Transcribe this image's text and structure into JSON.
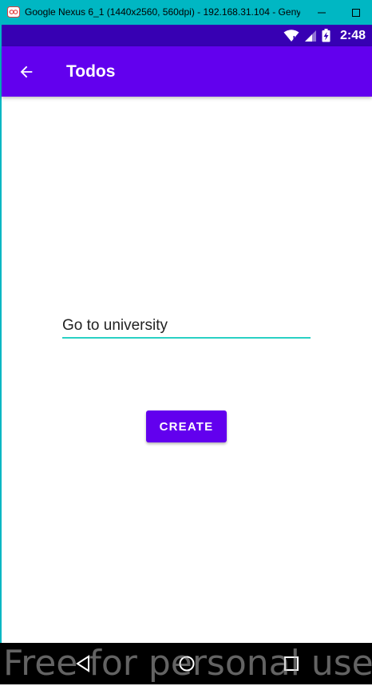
{
  "window": {
    "title": "Google Nexus 6_1 (1440x2560, 560dpi) - 192.168.31.104 - Genym..."
  },
  "status_bar": {
    "time": "2:48",
    "icons": [
      "wifi-icon",
      "signal-icon",
      "battery-charging-icon"
    ]
  },
  "app_bar": {
    "title": "Todos",
    "back_icon": "arrow-back-icon"
  },
  "form": {
    "todo_value": "Go to university",
    "create_label": "CREATE"
  },
  "nav_bar": {
    "icons": [
      "nav-back-icon",
      "nav-home-icon",
      "nav-recents-icon"
    ]
  },
  "watermark": "Free for personal use",
  "colors": {
    "primary": "#6200ee",
    "primary_dark": "#3700b3",
    "accent": "#2ad1c4",
    "window_frame": "#00b7c3"
  }
}
